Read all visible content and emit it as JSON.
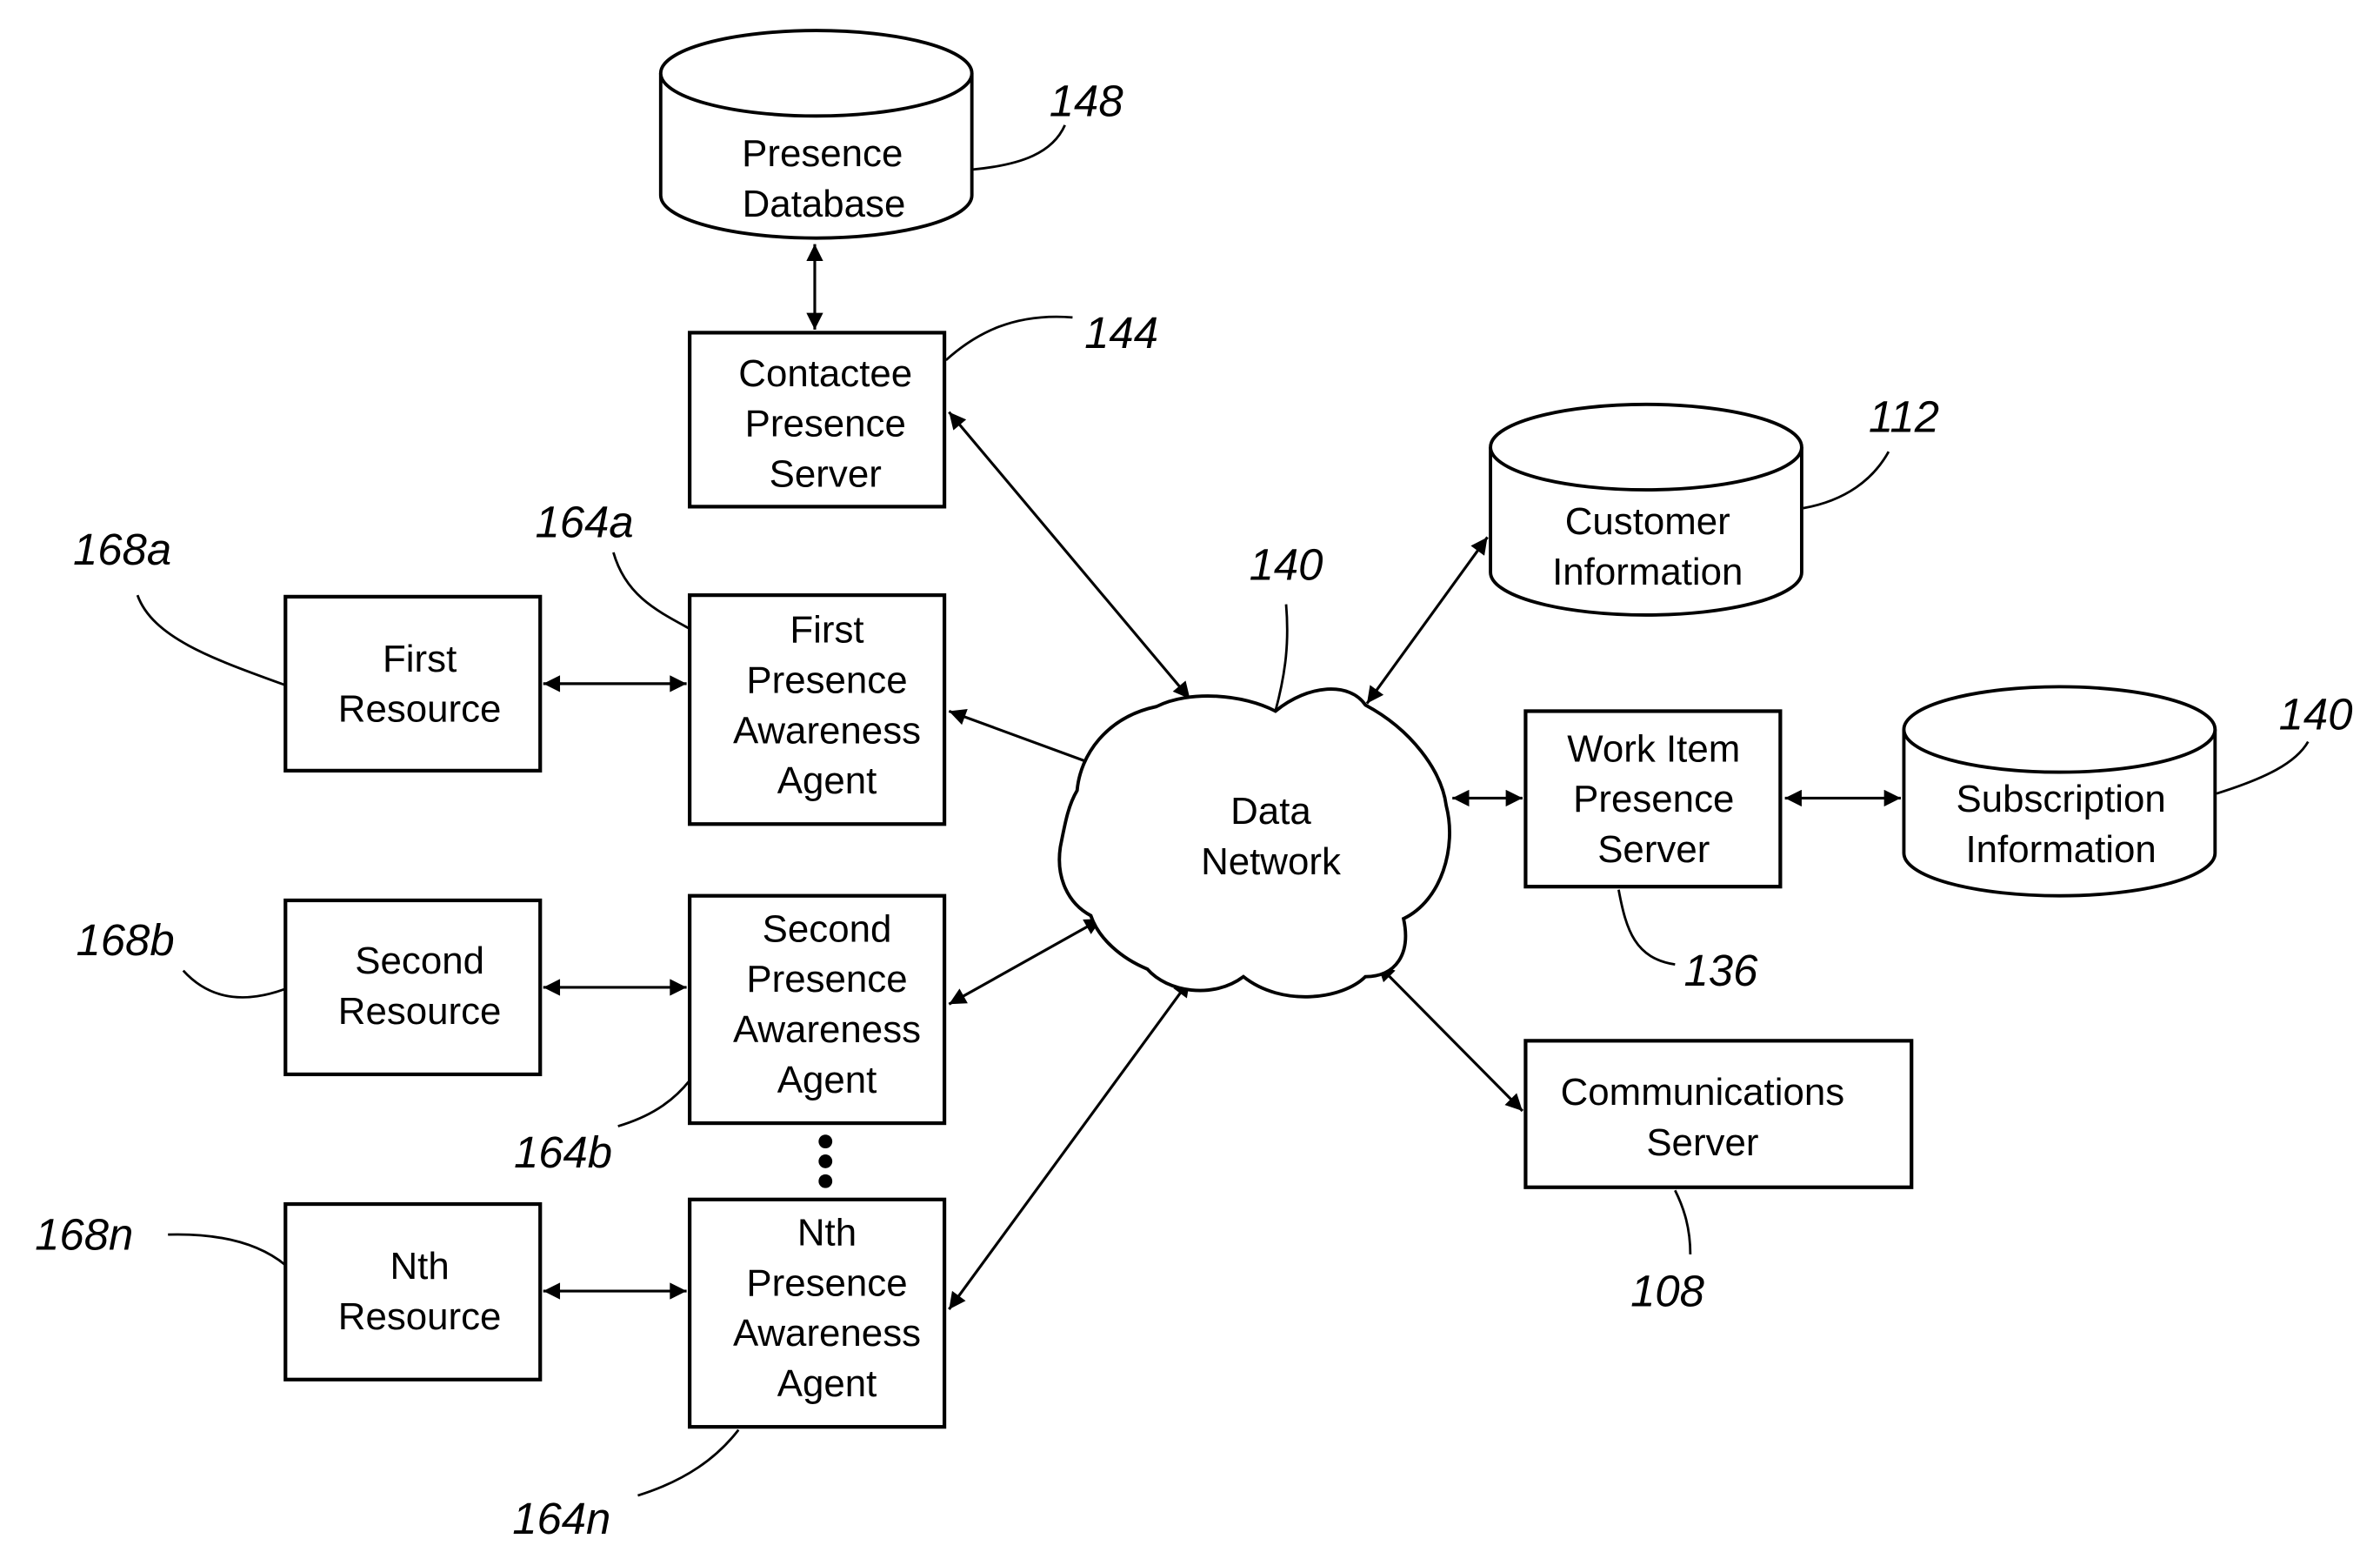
{
  "diagram": {
    "nodes": {
      "presence_database": {
        "lines": [
          "Presence",
          "Database"
        ],
        "ref": "148"
      },
      "contactee_presence_server": {
        "lines": [
          "Contactee",
          "Presence",
          "Server"
        ],
        "ref": "144"
      },
      "customer_information": {
        "lines": [
          "Customer",
          "Information"
        ],
        "ref": "112"
      },
      "data_network": {
        "lines": [
          "Data",
          "Network"
        ],
        "ref": "140"
      },
      "work_item_presence_server": {
        "lines": [
          "Work Item",
          "Presence",
          "Server"
        ],
        "ref": "136"
      },
      "subscription_information": {
        "lines": [
          "Subscription",
          "Information"
        ],
        "ref": "140"
      },
      "communications_server": {
        "lines": [
          "Communications",
          "Server"
        ],
        "ref": "108"
      },
      "first_resource": {
        "lines": [
          "First",
          "Resource"
        ],
        "ref": "168a"
      },
      "first_presence_awareness_agent": {
        "lines": [
          "First",
          "Presence",
          "Awareness",
          "Agent"
        ],
        "ref": "164a"
      },
      "second_resource": {
        "lines": [
          "Second",
          "Resource"
        ],
        "ref": "168b"
      },
      "second_presence_awareness_agent": {
        "lines": [
          "Second",
          "Presence",
          "Awareness",
          "Agent"
        ],
        "ref": "164b"
      },
      "nth_resource": {
        "lines": [
          "Nth",
          "Resource"
        ],
        "ref": "168n"
      },
      "nth_presence_awareness_agent": {
        "lines": [
          "Nth",
          "Presence",
          "Awareness",
          "Agent"
        ],
        "ref": "164n"
      }
    },
    "connections": [
      {
        "from": "presence_database",
        "to": "contactee_presence_server",
        "type": "bidirectional"
      },
      {
        "from": "contactee_presence_server",
        "to": "data_network",
        "type": "bidirectional"
      },
      {
        "from": "customer_information",
        "to": "data_network",
        "type": "bidirectional"
      },
      {
        "from": "first_resource",
        "to": "first_presence_awareness_agent",
        "type": "bidirectional"
      },
      {
        "from": "first_presence_awareness_agent",
        "to": "data_network",
        "type": "bidirectional"
      },
      {
        "from": "second_resource",
        "to": "second_presence_awareness_agent",
        "type": "bidirectional"
      },
      {
        "from": "second_presence_awareness_agent",
        "to": "data_network",
        "type": "bidirectional"
      },
      {
        "from": "nth_resource",
        "to": "nth_presence_awareness_agent",
        "type": "bidirectional"
      },
      {
        "from": "nth_presence_awareness_agent",
        "to": "data_network",
        "type": "bidirectional"
      },
      {
        "from": "data_network",
        "to": "work_item_presence_server",
        "type": "bidirectional"
      },
      {
        "from": "work_item_presence_server",
        "to": "subscription_information",
        "type": "bidirectional"
      },
      {
        "from": "data_network",
        "to": "communications_server",
        "type": "bidirectional"
      }
    ],
    "ellipsis": "⋮"
  }
}
